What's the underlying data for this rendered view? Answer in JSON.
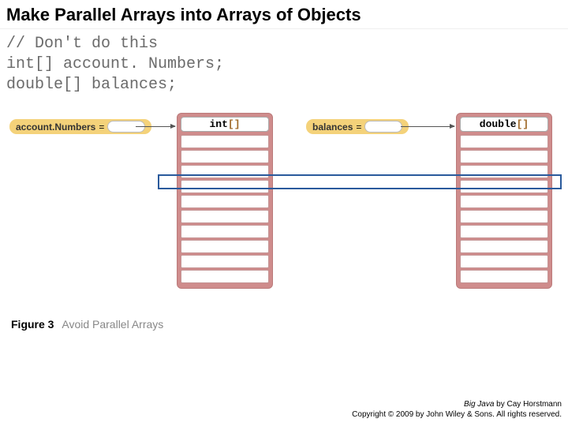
{
  "title": "Make Parallel Arrays into Arrays of Objects",
  "code": {
    "line1": "// Don't do this",
    "line2": "int[] account. Numbers;",
    "line3": "double[] balances;"
  },
  "diagram": {
    "var1": {
      "name": "account.Numbers",
      "eq": "="
    },
    "var2": {
      "name": "balances",
      "eq": "="
    },
    "type1": {
      "base": "int",
      "brackets": "[]"
    },
    "type2": {
      "base": "double",
      "brackets": "[]"
    },
    "cells_per_array": 10
  },
  "figure": {
    "label": "Figure 3",
    "caption": "Avoid Parallel Arrays"
  },
  "footer": {
    "line1_book": "Big Java",
    "line1_rest": " by Cay Horstmann",
    "line2": "Copyright © 2009 by John Wiley & Sons.  All rights reserved."
  }
}
